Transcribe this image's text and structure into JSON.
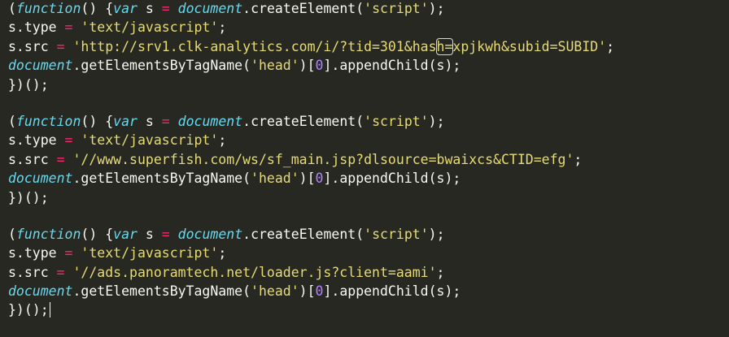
{
  "editor": {
    "blocks": [
      {
        "l1": {
          "open": "(",
          "fn": "function",
          "parens": "() {",
          "var": "var",
          "s": " s ",
          "eq": "=",
          "sp": " ",
          "doc": "document",
          "call": ".createElement(",
          "arg": "'script'",
          "end": ");"
        },
        "l2": {
          "lhs": "s.type ",
          "eq": "=",
          "sp": " ",
          "val": "'text/javascript'",
          "end": ";"
        },
        "l3": {
          "lhs": "s.src ",
          "eq": "=",
          "sp": " ",
          "val_a": "'http://srv1.clk-analytics.com/i/?tid=301&has",
          "val_hl": "h=",
          "val_b": "xpjkwh&subid=SUBID'",
          "end": ";"
        },
        "l4": {
          "doc": "document",
          "call": ".getElementsByTagName(",
          "arg": "'head'",
          "br1": ")[",
          "idx": "0",
          "br2": "].appendChild(s);"
        },
        "l5": {
          "text": "})();"
        }
      },
      {
        "l1": {
          "open": "(",
          "fn": "function",
          "parens": "() {",
          "var": "var",
          "s": " s ",
          "eq": "=",
          "sp": " ",
          "doc": "document",
          "call": ".createElement(",
          "arg": "'script'",
          "end": ");"
        },
        "l2": {
          "lhs": "s.type ",
          "eq": "=",
          "sp": " ",
          "val": "'text/javascript'",
          "end": ";"
        },
        "l3": {
          "lhs": "s.src ",
          "eq": "=",
          "sp": " ",
          "val": "'//www.superfish.com/ws/sf_main.jsp?dlsource=bwaixcs&CTID=efg'",
          "end": ";"
        },
        "l4": {
          "doc": "document",
          "call": ".getElementsByTagName(",
          "arg": "'head'",
          "br1": ")[",
          "idx": "0",
          "br2": "].appendChild(s);"
        },
        "l5": {
          "text": "})();"
        }
      },
      {
        "l1": {
          "open": "(",
          "fn": "function",
          "parens": "() {",
          "var": "var",
          "s": " s ",
          "eq": "=",
          "sp": " ",
          "doc": "document",
          "call": ".createElement(",
          "arg": "'script'",
          "end": ");"
        },
        "l2": {
          "lhs": "s.type ",
          "eq": "=",
          "sp": " ",
          "val": "'text/javascript'",
          "end": ";"
        },
        "l3": {
          "lhs": "s.src ",
          "eq": "=",
          "sp": " ",
          "val": "'//ads.panoramtech.net/loader.js?client=aami'",
          "end": ";"
        },
        "l4": {
          "doc": "document",
          "call": ".getElementsByTagName(",
          "arg": "'head'",
          "br1": ")[",
          "idx": "0",
          "br2": "].appendChild(s);"
        },
        "l5": {
          "text": "})();"
        }
      }
    ]
  },
  "colors": {
    "background": "#272822",
    "keyword": "#66d9ef",
    "operator": "#f92672",
    "string": "#e6db74",
    "number": "#ae81ff",
    "plain": "#f8f8f2"
  }
}
